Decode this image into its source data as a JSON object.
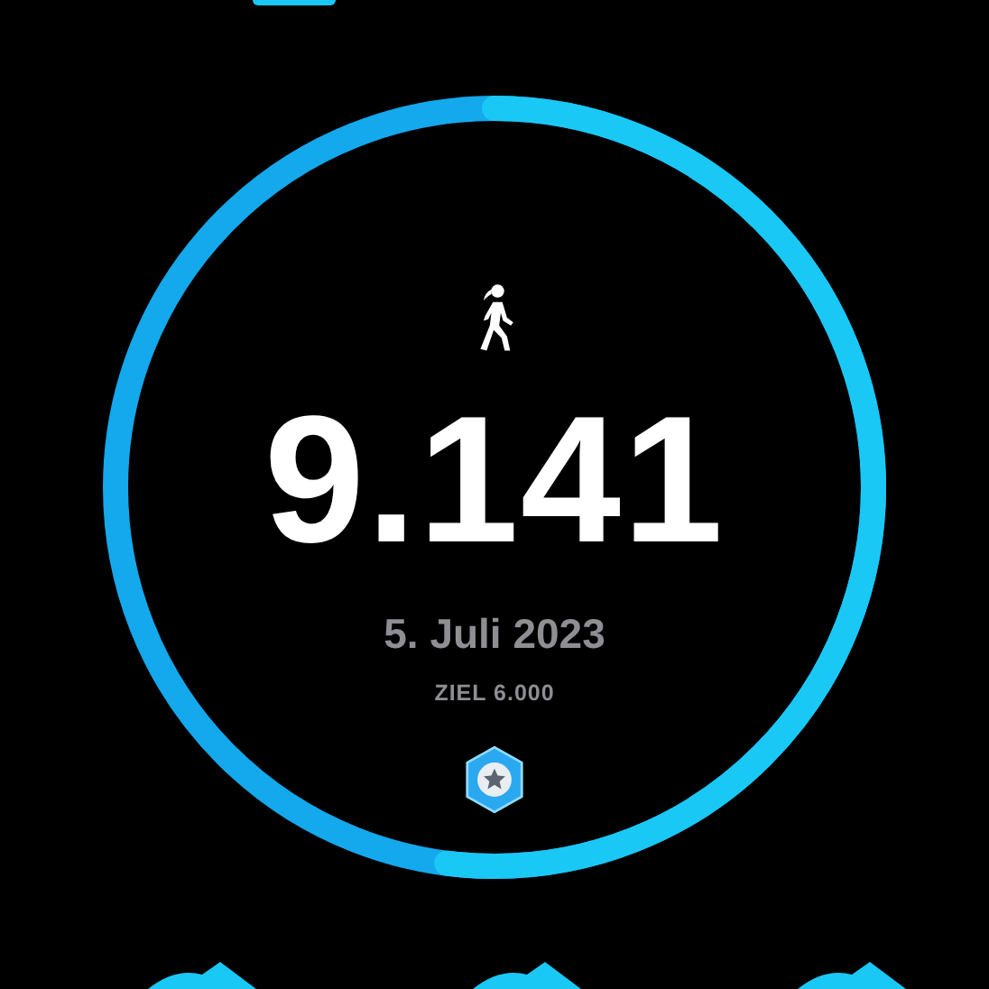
{
  "steps": "9.141",
  "date": "5. Juli 2023",
  "goal": "ZIEL 6.000"
}
